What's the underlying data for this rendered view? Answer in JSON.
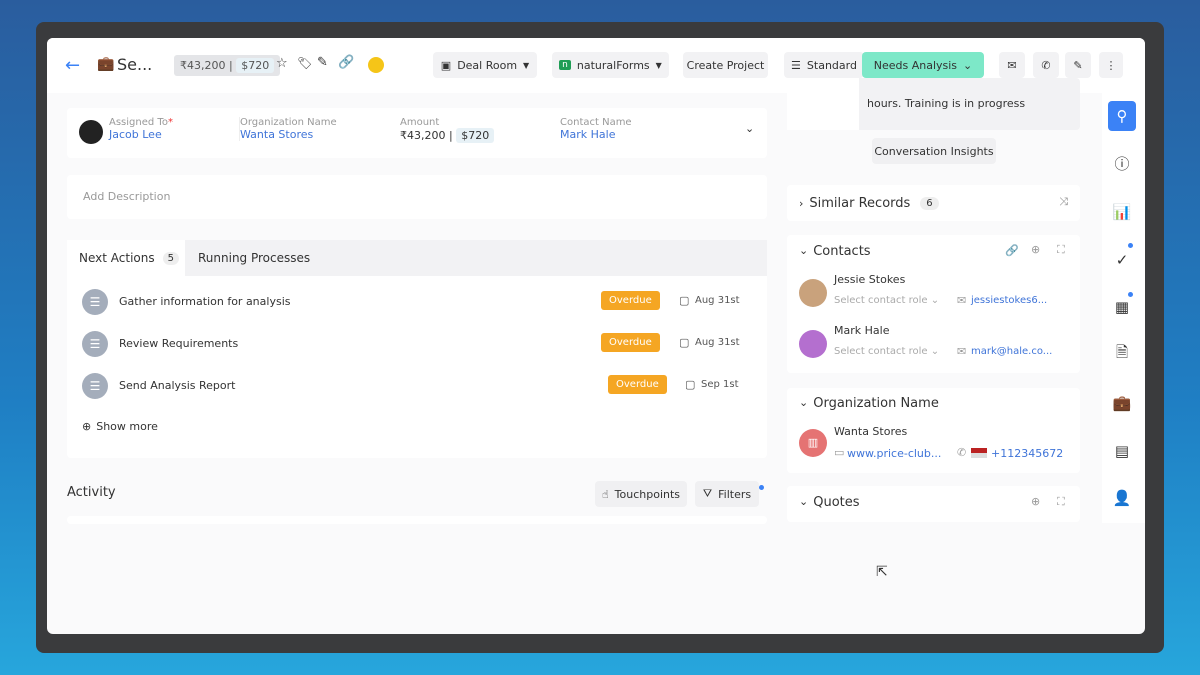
{
  "header": {
    "title": "Se...",
    "amount_inr": "₹43,200 |",
    "amount_usd": "$720",
    "deal_room": "Deal Room",
    "natural_forms": "naturalForms",
    "create_project": "Create Project",
    "pipeline": "Standard",
    "stage": "Needs Analysis"
  },
  "summary": {
    "assigned_label": "Assigned To",
    "assigned_required": "*",
    "assigned_value": "Jacob Lee",
    "org_label": "Organization Name",
    "org_value": "Wanta Stores",
    "amount_label": "Amount",
    "amount_inr": "₹43,200 |",
    "amount_usd": "$720",
    "contact_label": "Contact Name",
    "contact_value": "Mark Hale"
  },
  "description_placeholder": "Add Description",
  "tabs": {
    "next_actions": "Next Actions",
    "next_actions_count": "5",
    "running": "Running Processes"
  },
  "actions": [
    {
      "title": "Gather information for analysis",
      "status": "Overdue",
      "date": "Aug 31st"
    },
    {
      "title": "Review Requirements",
      "status": "Overdue",
      "date": "Aug 31st"
    },
    {
      "title": "Send Analysis Report",
      "status": "Overdue",
      "date": "Sep 1st"
    }
  ],
  "show_more": "Show more",
  "activity": {
    "title": "Activity",
    "touchpoints": "Touchpoints",
    "filters": "Filters"
  },
  "right": {
    "insight_text": "hours. Training is in progress",
    "conversation_insights": "Conversation Insights",
    "similar_records": "Similar Records",
    "similar_count": "6",
    "contacts_title": "Contacts",
    "contacts": [
      {
        "name": "Jessie Stokes",
        "role_placeholder": "Select contact role",
        "email": "jessiestokes6..."
      },
      {
        "name": "Mark Hale",
        "role_placeholder": "Select contact role",
        "email": "mark@hale.co..."
      }
    ],
    "org_title": "Organization Name",
    "org_name": "Wanta Stores",
    "org_website": "www.price-club...",
    "org_phone": "+112345672",
    "quotes_title": "Quotes"
  },
  "colors": {
    "accent": "#3b82f6",
    "stage": "#7de8c8",
    "overdue": "#f5a623"
  }
}
